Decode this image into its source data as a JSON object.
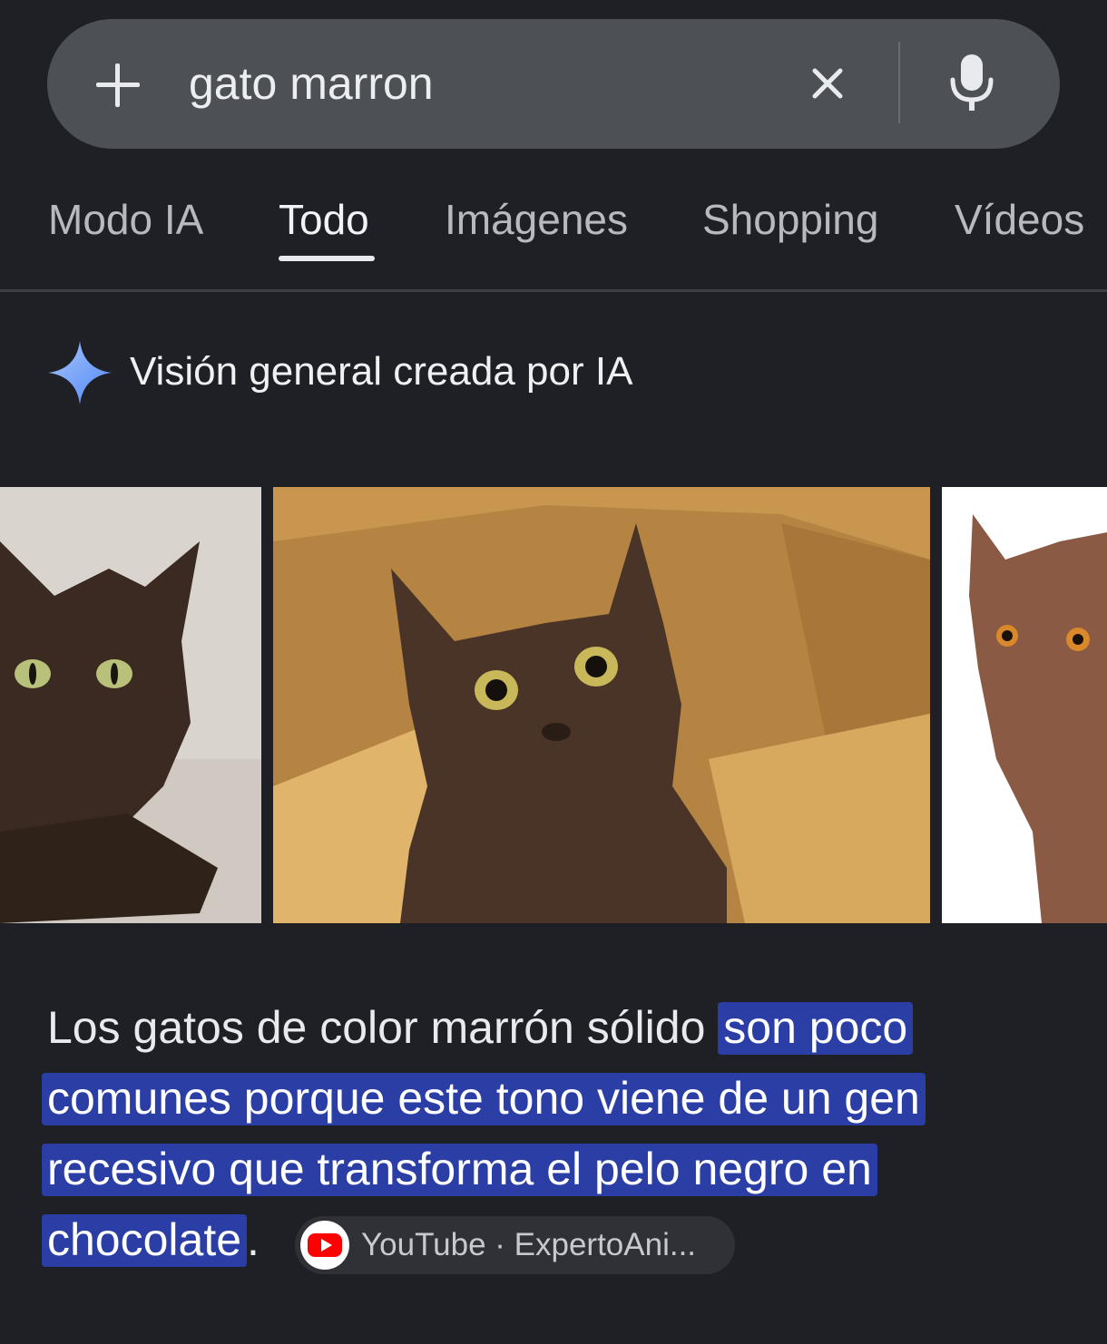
{
  "search": {
    "query": "gato marron",
    "icons": [
      "plus-icon",
      "clear-icon",
      "mic-icon"
    ]
  },
  "tabs": [
    {
      "label": "Modo IA",
      "active": false
    },
    {
      "label": "Todo",
      "active": true
    },
    {
      "label": "Imágenes",
      "active": false
    },
    {
      "label": "Shopping",
      "active": false
    },
    {
      "label": "Vídeos",
      "active": false
    }
  ],
  "ai_overview": {
    "title": "Visión general creada por IA",
    "icon": "sparkle-icon",
    "images": [
      "brown-cat-photo",
      "brown-cat-in-box-photo",
      "chocolate-cat-photo"
    ],
    "text_plain": "Los gatos de color marrón sólido ",
    "text_highlight_1": "son poco",
    "text_highlight_2": "comunes porque este tono viene de un gen",
    "text_highlight_3": "recesivo que transforma el pelo negro en",
    "text_highlight_4": "chocolate",
    "text_end": ".",
    "source": {
      "icon": "youtube-icon",
      "label": "YouTube · ExpertoAni..."
    }
  },
  "colors": {
    "background": "#1f2025",
    "search_bar": "#4d5055",
    "highlight": "#2a3ea6",
    "sparkle": "#8ab4f8"
  }
}
